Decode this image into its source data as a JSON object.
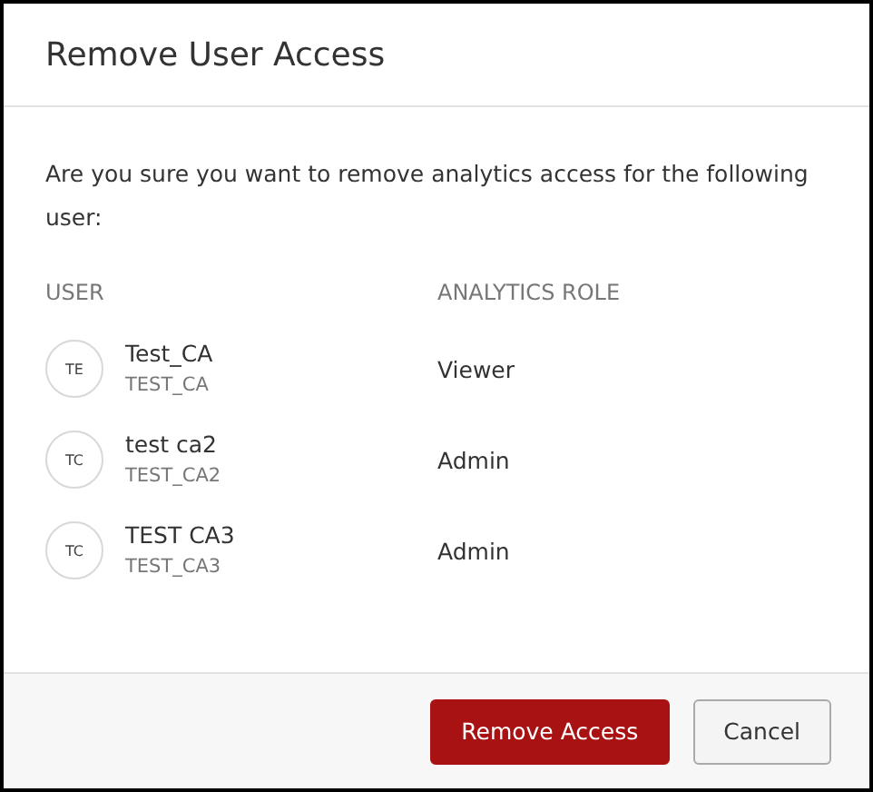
{
  "dialog": {
    "title": "Remove User Access",
    "message": "Are you sure you want to remove analytics access for the following user:"
  },
  "table": {
    "columns": [
      "USER",
      "ANALYTICS ROLE"
    ],
    "rows": [
      {
        "initials": "TE",
        "name": "Test_CA",
        "username": "TEST_CA",
        "role": "Viewer"
      },
      {
        "initials": "TC",
        "name": "test ca2",
        "username": "TEST_CA2",
        "role": "Admin"
      },
      {
        "initials": "TC",
        "name": "TEST CA3",
        "username": "TEST_CA3",
        "role": "Admin"
      }
    ]
  },
  "buttons": [
    {
      "kind": "primary",
      "label": "Remove Access"
    },
    {
      "kind": "secondary",
      "label": "Cancel"
    }
  ]
}
